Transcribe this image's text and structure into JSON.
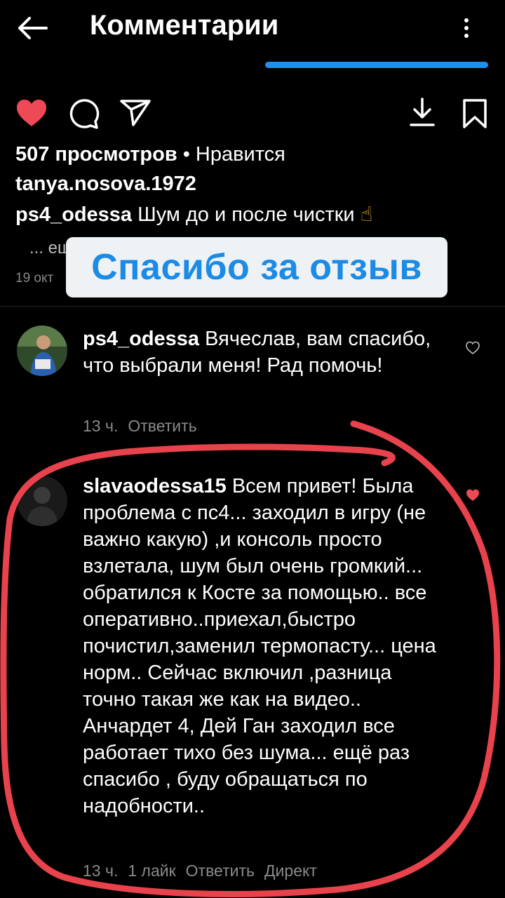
{
  "header": {
    "title": "Комментарии",
    "back_icon": "arrow-left-icon",
    "menu_icon": "more-vertical-icon"
  },
  "actions": {
    "like_icon": "heart-filled-icon",
    "comment_icon": "comment-icon",
    "share_icon": "send-icon",
    "download_icon": "download-icon",
    "save_icon": "bookmark-icon",
    "like_color": "#ed4956"
  },
  "post": {
    "views_text": "507 просмотров",
    "likes_separator": " • Нравится",
    "liked_by": "tanya.nosova.1972",
    "author": "ps4_odessa",
    "caption": "Шум до и после чистки",
    "caption_emoji": "☝",
    "more_text": "... ещё",
    "date": "19 окт"
  },
  "overlay": {
    "text": "Спасибо за отзыв",
    "text_color": "#1c8be6",
    "bg_color": "#eef2f5"
  },
  "comments": [
    {
      "username": "ps4_odessa",
      "text": "Вячеслав, вам спасибо, что выбрали меня! Рад помочь!",
      "time": "13 ч.",
      "reply": "Ответить",
      "liked": false
    },
    {
      "username": "slavaodessa15",
      "text": "Всем привет! Была проблема с пс4... заходил в игру (не важно какую) ,и консоль просто взлетала, шум был очень громкий... обратился к Косте за помощью.. все оперативно..приехал,быстро почистил,заменил термопасту... цена норм.. Сейчас включил ,разница точно такая же как на видео.. Анчардет 4, Дей Ган заходил все работает тихо без шума... ещё раз спасибо , буду обращаться по надобности..",
      "time": "13 ч.",
      "likes": "1 лайк",
      "reply": "Ответить",
      "direct": "Директ",
      "liked": true
    }
  ],
  "annotation": {
    "type": "hand-drawn-circle",
    "color": "#e8434c"
  }
}
